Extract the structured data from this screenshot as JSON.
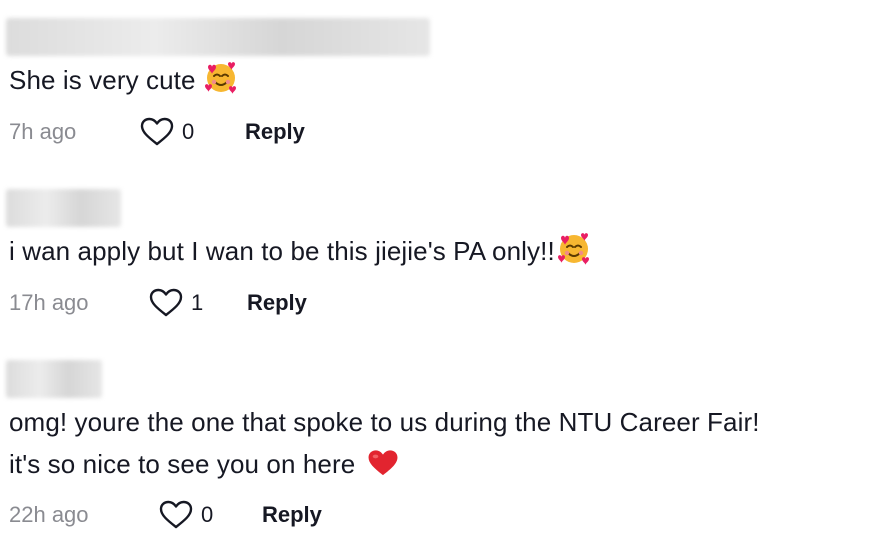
{
  "comments": [
    {
      "text": "She is very cute",
      "emoji": "smiling-face-with-hearts",
      "time": "7h ago",
      "likes": "0",
      "reply_label": "Reply"
    },
    {
      "text": "i wan apply but I wan to be this jiejie's PA only!!",
      "emoji": "smiling-face-with-hearts",
      "time": "17h ago",
      "likes": "1",
      "reply_label": "Reply"
    },
    {
      "text_line1": "omg! youre the one that spoke to us during the NTU Career Fair!",
      "text_line2": "it's so nice to see you on here",
      "emoji": "red-heart",
      "time": "22h ago",
      "likes": "0",
      "reply_label": "Reply"
    }
  ]
}
